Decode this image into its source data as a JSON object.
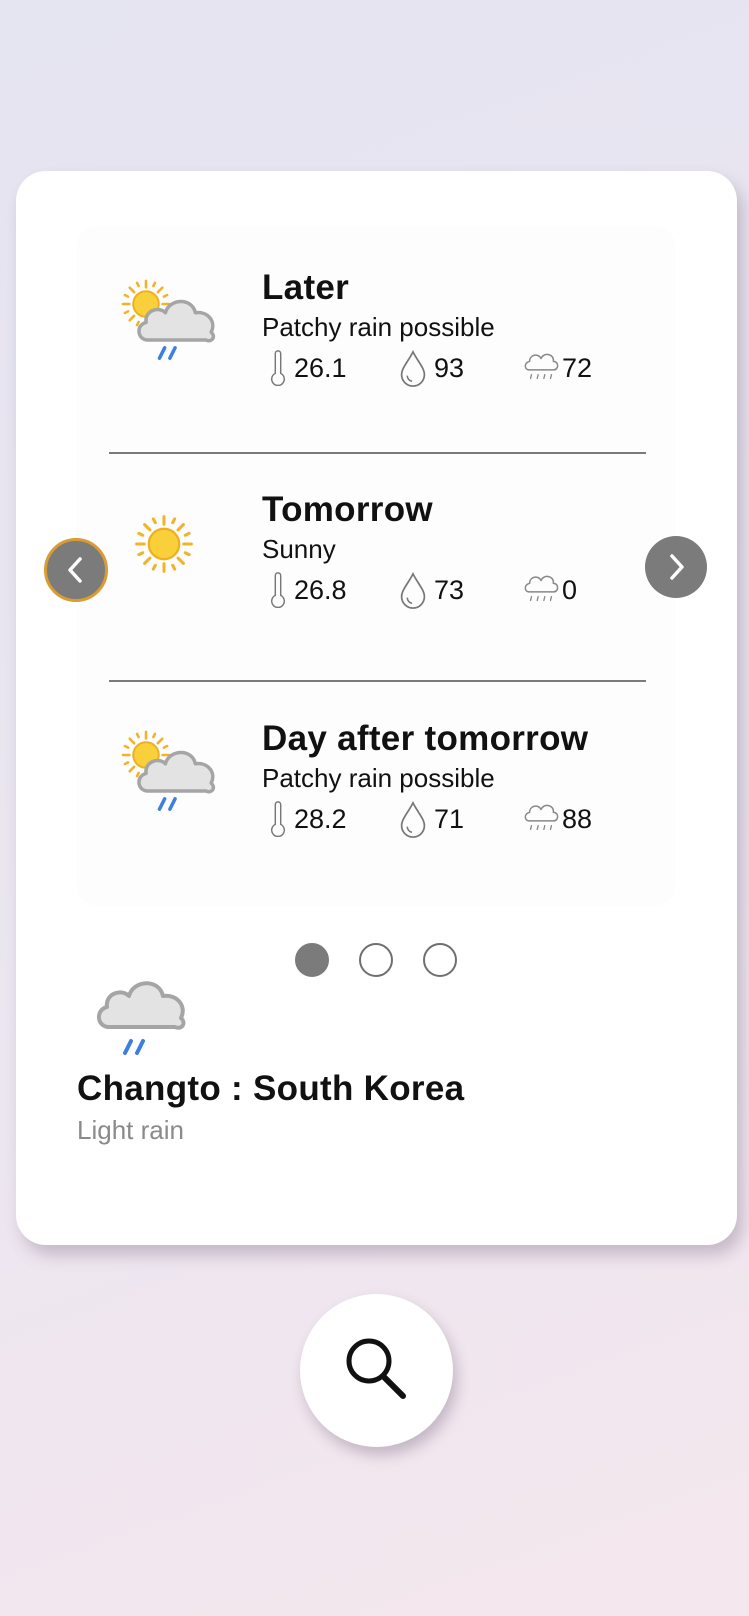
{
  "forecast": [
    {
      "title": "Later",
      "condition": "Patchy rain possible",
      "icon": "sun-cloud-rain-icon",
      "temp": "26.1",
      "humidity": "93",
      "rain_chance": "72"
    },
    {
      "title": "Tomorrow",
      "condition": "Sunny",
      "icon": "sun-icon",
      "temp": "26.8",
      "humidity": "73",
      "rain_chance": "0"
    },
    {
      "title": "Day after tomorrow",
      "condition": "Patchy rain possible",
      "icon": "sun-cloud-rain-icon",
      "temp": "28.2",
      "humidity": "71",
      "rain_chance": "88"
    }
  ],
  "pagination": {
    "pages": 3,
    "active_index": 0
  },
  "current": {
    "icon": "cloud-rain-icon",
    "location": "Changto : South Korea",
    "description": "Light rain"
  },
  "icons": {
    "prev": "chevron-left-icon",
    "next": "chevron-right-icon",
    "search": "search-icon",
    "temperature": "thermometer-icon",
    "humidity": "droplet-icon",
    "rain": "rain-cloud-icon"
  },
  "colors": {
    "nav_button": "#7b7b7b",
    "nav_focus_ring": "#d99b32",
    "sun": "#f6c12a",
    "rain": "#3b7fe0",
    "secondary_text": "#8a8a8a"
  }
}
